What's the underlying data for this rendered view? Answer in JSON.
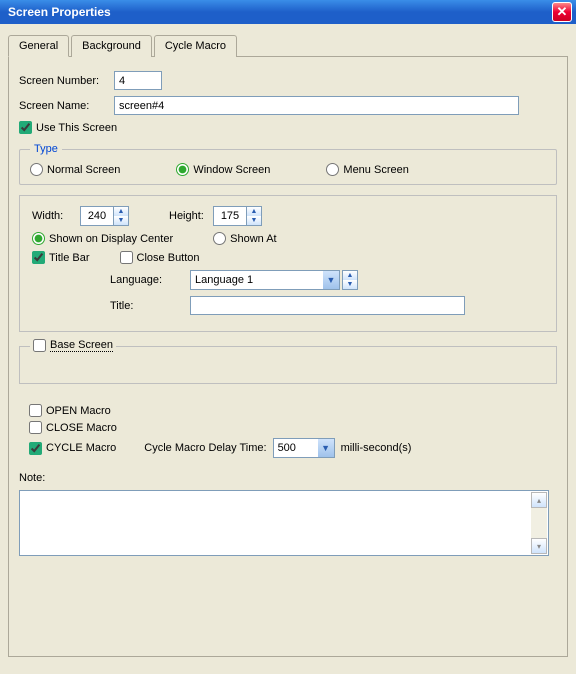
{
  "window": {
    "title": "Screen Properties"
  },
  "tabs": {
    "general": "General",
    "background": "Background",
    "cycle": "Cycle Macro"
  },
  "labels": {
    "screen_number": "Screen Number:",
    "screen_name": "Screen Name:",
    "use_this_screen": "Use This Screen",
    "type_legend": "Type",
    "normal_screen": "Normal Screen",
    "window_screen": "Window Screen",
    "menu_screen": "Menu Screen",
    "width": "Width:",
    "height": "Height:",
    "shown_center": "Shown on Display Center",
    "shown_at": "Shown At",
    "title_bar": "Title Bar",
    "close_button": "Close Button",
    "language": "Language:",
    "title": "Title:",
    "base_screen": "Base Screen",
    "open_macro": "OPEN Macro",
    "close_macro": "CLOSE Macro",
    "cycle_macro": "CYCLE Macro",
    "cycle_delay": "Cycle Macro Delay Time:",
    "ms": "milli-second(s)",
    "note": "Note:"
  },
  "values": {
    "screen_number": "4",
    "screen_name": "screen#4",
    "use_this_screen": true,
    "type": "window",
    "width": "240",
    "height": "175",
    "position": "center",
    "title_bar": true,
    "close_button": false,
    "language": "Language 1",
    "title": "",
    "base_screen": false,
    "open_macro": false,
    "close_macro": false,
    "cycle_macro": true,
    "cycle_delay": "500",
    "note": ""
  }
}
